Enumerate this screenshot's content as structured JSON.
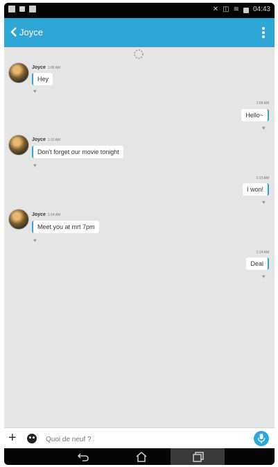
{
  "status_bar": {
    "time": "04:43"
  },
  "header": {
    "title": "Joyce"
  },
  "messages": [
    {
      "direction": "in",
      "sender": "Joyce",
      "time": "1:06 AM",
      "text": "Hey"
    },
    {
      "direction": "out",
      "time": "1:09 AM",
      "text": "Hello~"
    },
    {
      "direction": "in",
      "sender": "Joyce",
      "time": "1:10 AM",
      "text": "Don't forget our movie tonight"
    },
    {
      "direction": "out",
      "time": "1:13 AM",
      "text": "I won!"
    },
    {
      "direction": "in",
      "sender": "Joyce",
      "time": "1:14 AM",
      "text": "Meet you at mrt 7pm"
    },
    {
      "direction": "out",
      "time": "1:14 AM",
      "text": "Deal"
    }
  ],
  "composer": {
    "placeholder": "Quoi de neuf ?"
  },
  "colors": {
    "accent": "#2ea6d6",
    "chat_bg": "#e5e5e5"
  },
  "icons": [
    "back-icon",
    "overflow-menu-icon",
    "plus-icon",
    "emoji-icon",
    "mic-icon",
    "nav-back-icon",
    "nav-home-icon",
    "nav-recents-icon"
  ]
}
